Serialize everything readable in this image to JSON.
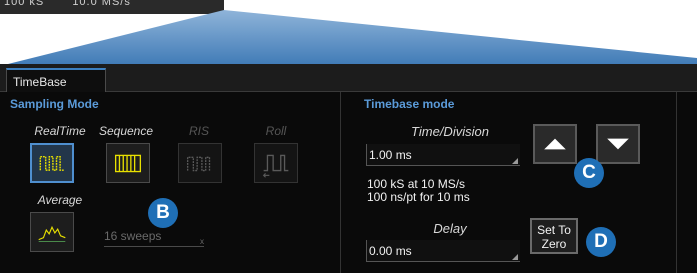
{
  "top_strip": {
    "left_text": "100 kS",
    "right_text": "10.0 MS/s"
  },
  "tabs": [
    {
      "label": "TimeBase"
    }
  ],
  "sampling": {
    "title": "Sampling Mode",
    "modes": [
      {
        "label": "RealTime",
        "icon": "realtime-waveform-icon",
        "selected": true,
        "enabled": true
      },
      {
        "label": "Sequence",
        "icon": "sequence-waveform-icon",
        "selected": false,
        "enabled": true
      },
      {
        "label": "RIS",
        "icon": "ris-waveform-icon",
        "selected": false,
        "enabled": false
      },
      {
        "label": "Roll",
        "icon": "roll-waveform-icon",
        "selected": false,
        "enabled": false
      }
    ],
    "average": {
      "label": "Average",
      "icon": "average-waveform-icon"
    },
    "sweeps": {
      "text": "16 sweeps",
      "corner": "x"
    }
  },
  "timebase": {
    "title": "Timebase mode",
    "time_division": {
      "label": "Time/Division",
      "value": "1.00 ms"
    },
    "info_line1": "100 kS at 10 MS/s",
    "info_line2": "100 ns/pt for 10 ms",
    "delay": {
      "label": "Delay",
      "value": "0.00 ms"
    },
    "up_button": "up-arrow-icon",
    "down_button": "down-arrow-icon",
    "set_zero_line1": "Set To",
    "set_zero_line2": "Zero"
  },
  "callouts": {
    "b": "B",
    "c": "C",
    "d": "D"
  },
  "colors": {
    "accent": "#5b9bd9",
    "callout": "#1f6fb6",
    "selected_border": "#4f8fcf",
    "waveform_yellow": "#e8e000"
  }
}
